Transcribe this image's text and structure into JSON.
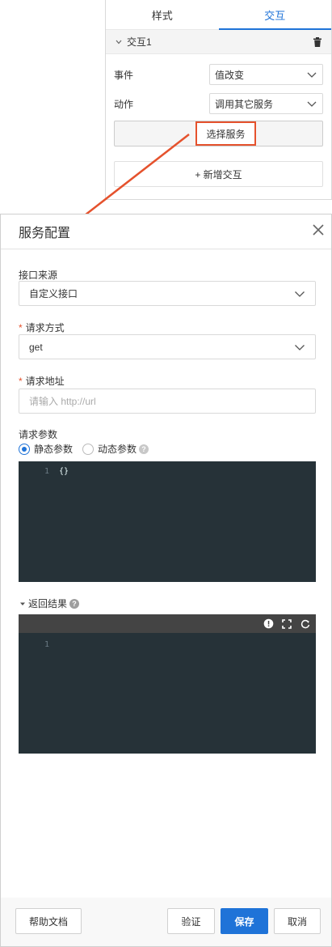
{
  "top_panel": {
    "tabs": [
      {
        "label": "样式",
        "active": false
      },
      {
        "label": "交互",
        "active": true
      }
    ],
    "group_title": "交互1",
    "event": {
      "label": "事件",
      "value": "值改变"
    },
    "action": {
      "label": "动作",
      "value": "调用其它服务"
    },
    "select_service_label": "选择服务",
    "add_interaction_label": "+ 新增交互"
  },
  "modal": {
    "title": "服务配置",
    "source": {
      "label": "接口来源",
      "value": "自定义接口"
    },
    "method": {
      "required_mark": "*",
      "label": "请求方式",
      "value": "get"
    },
    "address": {
      "required_mark": "*",
      "label": "请求地址",
      "value": "",
      "placeholder": "请输入 http://url"
    },
    "params": {
      "label": "请求参数",
      "options": [
        {
          "label": "静态参数",
          "checked": true
        },
        {
          "label": "动态参数",
          "checked": false
        }
      ],
      "help": "?",
      "editor": {
        "line_number": "1",
        "code": "{}"
      }
    },
    "result": {
      "label": "返回结果",
      "help": "?",
      "editor": {
        "line_number": "1",
        "code": ""
      }
    },
    "footer": {
      "help_doc": "帮助文档",
      "validate": "验证",
      "save": "保存",
      "cancel": "取消"
    }
  },
  "colors": {
    "accent": "#1f73d8",
    "highlight": "#e5522d",
    "editor_bg": "#263238"
  }
}
